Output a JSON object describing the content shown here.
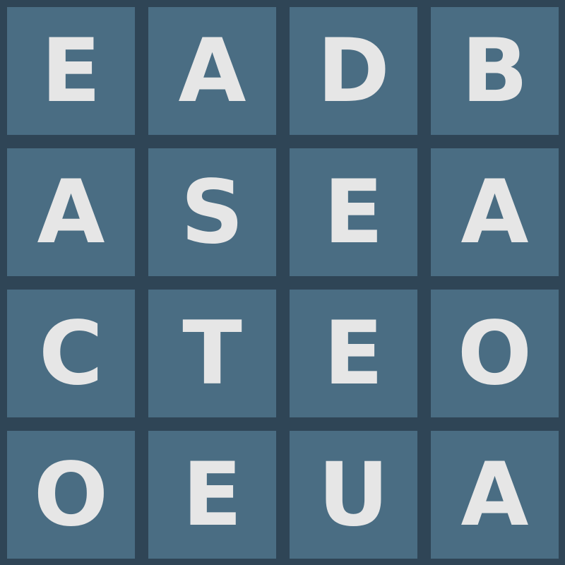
{
  "board": {
    "rows": [
      [
        "E",
        "A",
        "D",
        "B"
      ],
      [
        "A",
        "S",
        "E",
        "A"
      ],
      [
        "C",
        "T",
        "E",
        "O"
      ],
      [
        "O",
        "E",
        "U",
        "A"
      ]
    ],
    "colors": {
      "background": "#2f4556",
      "tile": "#4a6d83",
      "letter": "#e6e6e6"
    }
  }
}
